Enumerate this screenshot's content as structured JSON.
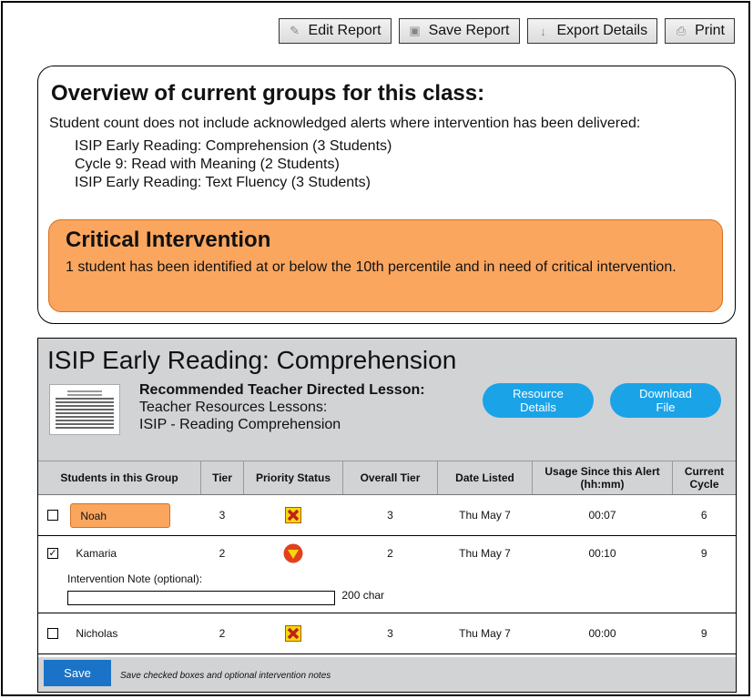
{
  "toolbar": {
    "buttons": [
      {
        "label": "Edit Report",
        "icon": "pencil-icon"
      },
      {
        "label": "Save Report",
        "icon": "disk-icon"
      },
      {
        "label": "Export Details",
        "icon": "arrow-down-icon"
      },
      {
        "label": "Print",
        "icon": "printer-icon"
      }
    ]
  },
  "overview": {
    "title": "Overview of current groups for this class:",
    "subtitle": "Student count does not include acknowledged alerts where intervention has been delivered:",
    "groups": [
      "ISIP Early Reading: Comprehension (3 Students)",
      "Cycle 9: Read with Meaning (2 Students)",
      "ISIP Early Reading: Text Fluency (3 Students)"
    ],
    "critical": {
      "title": "Critical Intervention",
      "text": "1 student has been identified at or below the 10th percentile and in need of critical intervention.",
      "color": "#fba65f"
    }
  },
  "group": {
    "title": "ISIP Early Reading: Comprehension",
    "lesson_heading": "Recommended Teacher Directed Lesson:",
    "lesson_line1": "Teacher Resources Lessons:",
    "lesson_line2": "ISIP - Reading Comprehension",
    "resource_button": "Resource\nDetails",
    "download_button": "Download\nFile",
    "columns": [
      "Students in this Group",
      "Tier",
      "Priority Status",
      "Overall Tier",
      "Date Listed",
      "Usage Since this Alert (hh:mm)",
      "Current Cycle"
    ],
    "rows": [
      {
        "checked": false,
        "name": "Noah",
        "tier": "3",
        "priority": "x-icon",
        "overall": "3",
        "date": "Thu May 7",
        "usage": "00:07",
        "cycle": "6",
        "highlight": true
      },
      {
        "checked": true,
        "name": "Kamaria",
        "tier": "2",
        "priority": "down-triangle-icon",
        "overall": "2",
        "date": "Thu May 7",
        "usage": "00:10",
        "cycle": "9",
        "highlight": false
      },
      {
        "checked": false,
        "name": "Nicholas",
        "tier": "2",
        "priority": "x-icon",
        "overall": "3",
        "date": "Thu May 7",
        "usage": "00:00",
        "cycle": "9",
        "highlight": false
      }
    ],
    "note_label": "Intervention Note (optional):",
    "note_limit": "200 char",
    "save_label": "Save",
    "save_note": "Save checked boxes and optional intervention notes"
  },
  "colors": {
    "accent": "#1ba3e8",
    "save": "#1a73c6",
    "critical": "#fba65f",
    "panel": "#d2d3d5"
  }
}
